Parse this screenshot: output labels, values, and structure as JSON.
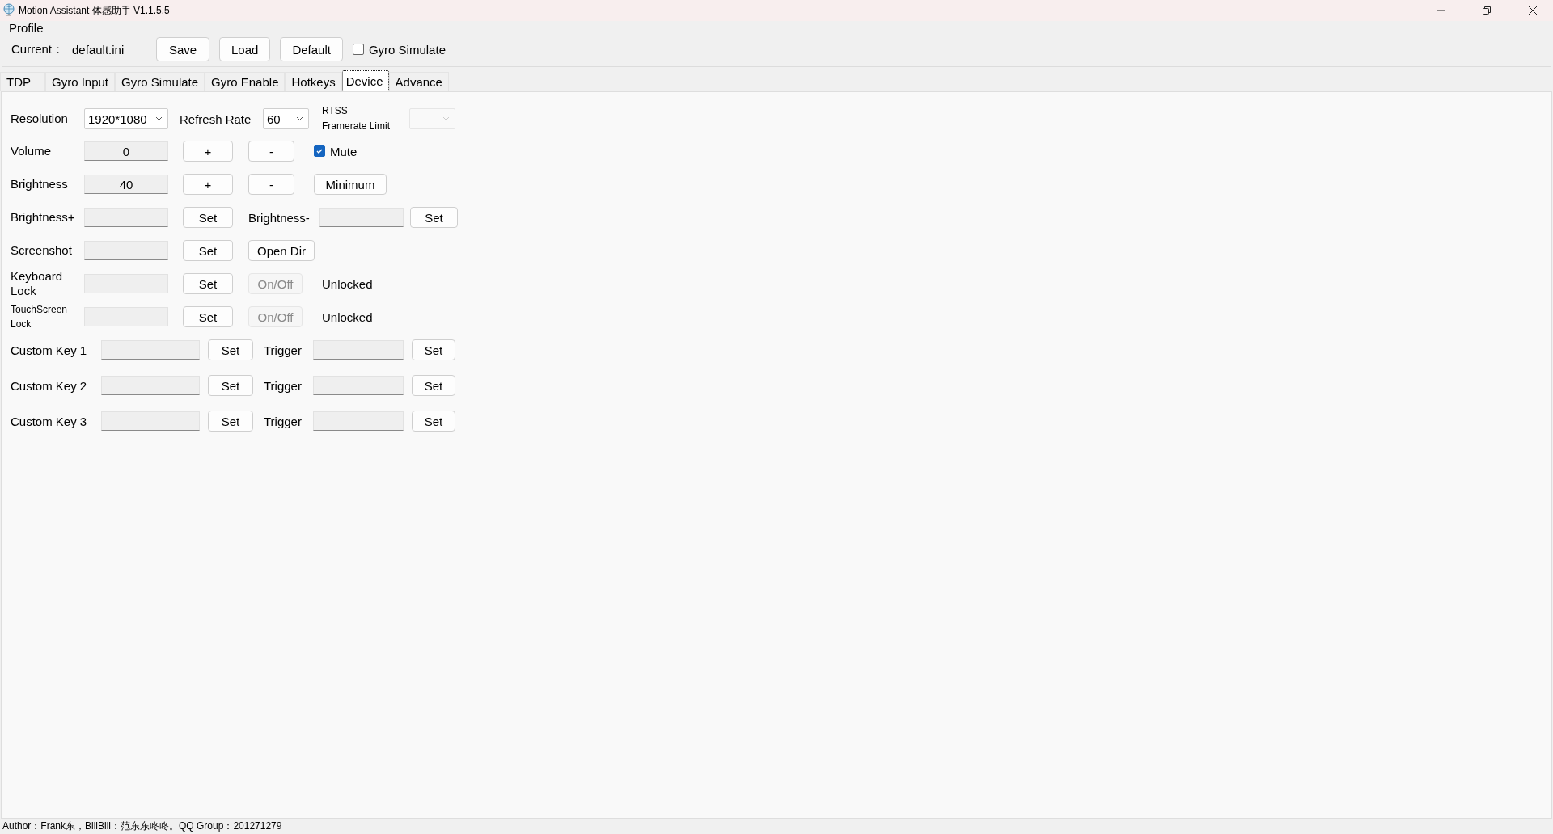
{
  "window": {
    "title": "Motion Assistant 体感助手 V1.1.5.5"
  },
  "profile": {
    "legend": "Profile",
    "current_label": "Current：",
    "current_value": "default.ini",
    "buttons": [
      "Save",
      "Load",
      "Default"
    ],
    "gyro_simulate": {
      "label": "Gyro Simulate",
      "checked": false
    }
  },
  "tabs": [
    {
      "label": "TDP",
      "selected": false
    },
    {
      "label": "Gyro Input",
      "selected": false
    },
    {
      "label": "Gyro Simulate",
      "selected": false
    },
    {
      "label": "Gyro Enable",
      "selected": false
    },
    {
      "label": "Hotkeys",
      "selected": false
    },
    {
      "label": "Device",
      "selected": true
    },
    {
      "label": "Advance",
      "selected": false
    }
  ],
  "display": {
    "resolution_label": "Resolution",
    "resolution_value": "1920*1080",
    "refresh_label": "Refresh Rate",
    "refresh_value": "60",
    "rtss_label_lines": [
      "RTSS",
      "Framerate Limit"
    ],
    "rtss_disabled": true
  },
  "volume": {
    "label": "Volume",
    "value": "0",
    "plus": "+",
    "minus": "-",
    "mute": {
      "label": "Mute",
      "checked": true
    }
  },
  "brightness": {
    "label": "Brightness",
    "value": "40",
    "plus": "+",
    "minus": "-",
    "minimum": "Minimum"
  },
  "brightness_keys": {
    "plus_label": "Brightness+",
    "plus_set": "Set",
    "minus_label": "Brightness-",
    "minus_set": "Set"
  },
  "screenshot": {
    "label": "Screenshot",
    "set": "Set",
    "open_dir": "Open Dir"
  },
  "locks": [
    {
      "label": "Keyboard Lock",
      "set": "Set",
      "toggle": "On/Off",
      "toggle_disabled": true,
      "status": "Unlocked"
    },
    {
      "label": "TouchScreen Lock",
      "set": "Set",
      "toggle": "On/Off",
      "toggle_disabled": true,
      "status": "Unlocked"
    }
  ],
  "custom_keys": [
    {
      "label": "Custom Key 1",
      "set": "Set",
      "trigger_label": "Trigger",
      "trigger_set": "Set"
    },
    {
      "label": "Custom Key 2",
      "set": "Set",
      "trigger_label": "Trigger",
      "trigger_set": "Set"
    },
    {
      "label": "Custom Key 3",
      "set": "Set",
      "trigger_label": "Trigger",
      "trigger_set": "Set"
    }
  ],
  "status_bar": "Author：Frank东，BiliBili：范东东咚咚。QQ Group：201271279"
}
